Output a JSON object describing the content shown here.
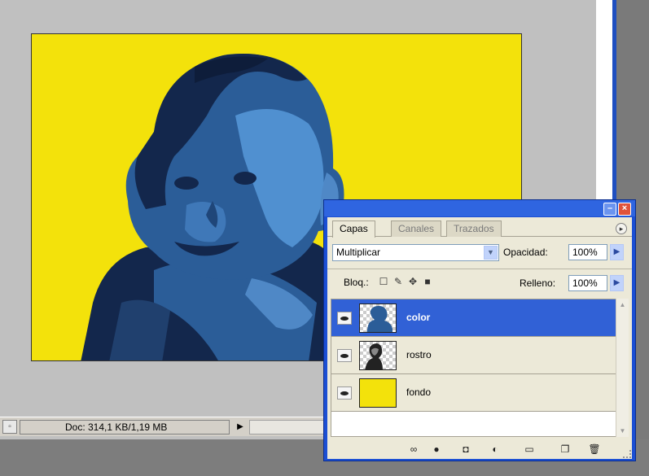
{
  "status_bar": {
    "doc_info": "Doc: 314,1 KB/1,19 MB"
  },
  "layers_panel": {
    "tabs": [
      "Capas",
      "Canales",
      "Trazados"
    ],
    "blend_mode": "Multiplicar",
    "opacity_label": "Opacidad:",
    "opacity_value": "100%",
    "lock_label": "Bloq.:",
    "fill_label": "Relleno:",
    "fill_value": "100%",
    "layers": [
      {
        "name": "color",
        "selected": true,
        "visible": true
      },
      {
        "name": "rostro",
        "selected": false,
        "visible": true
      },
      {
        "name": "fondo",
        "selected": false,
        "visible": true
      }
    ],
    "toolbar_icons": [
      "link-icon",
      "layer-style-icon",
      "mask-icon",
      "adjustment-icon",
      "group-folder-icon",
      "new-layer-icon",
      "trash-icon"
    ]
  },
  "colors": {
    "canvas_background": "#f3e20b",
    "selection_blue": "#3161d6",
    "panel_frame": "#1b4fd4",
    "portrait_dark": "#13274c",
    "portrait_mid": "#2b5d98",
    "portrait_light": "#5090d0"
  }
}
